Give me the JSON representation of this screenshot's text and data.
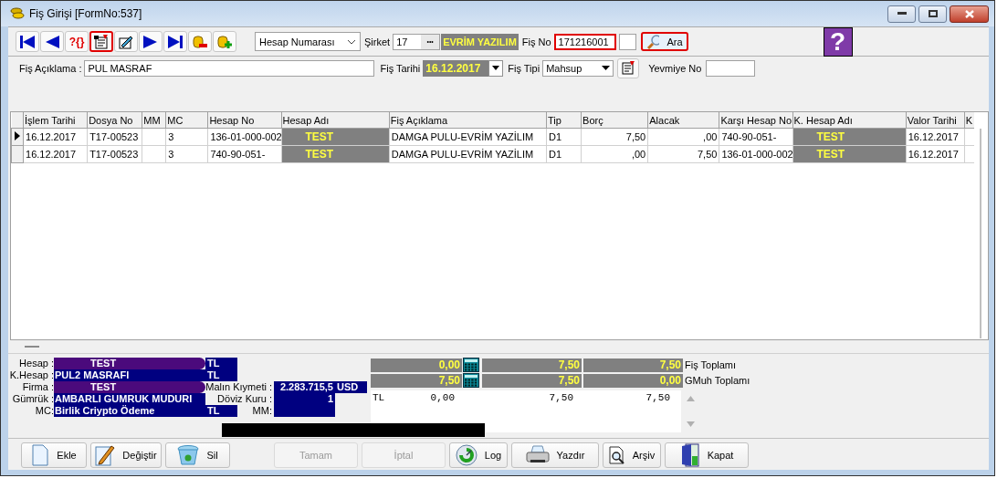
{
  "window": {
    "title": "Fiş Girişi [FormNo:537]"
  },
  "toolbar": [
    {
      "kind": "first",
      "highlighted": false
    },
    {
      "kind": "prev",
      "highlighted": false
    },
    {
      "kind": "query",
      "label": "?{}",
      "highlighted": false
    },
    {
      "kind": "import",
      "highlighted": true
    },
    {
      "kind": "edit",
      "highlighted": false
    },
    {
      "kind": "next",
      "highlighted": false
    },
    {
      "kind": "last",
      "highlighted": false
    },
    {
      "kind": "remove",
      "highlighted": false
    },
    {
      "kind": "add",
      "highlighted": false
    }
  ],
  "lookup": {
    "value": "Hesap Numarası"
  },
  "company": {
    "label": "Şirket",
    "value": "17",
    "button": "•••",
    "name": "EVRİM YAZILIM"
  },
  "fis_no": {
    "label": "Fiş No",
    "value": "171216001",
    "highlighted": true
  },
  "search_button": {
    "label": "Ara",
    "highlighted": true
  },
  "help": {
    "label": "?"
  },
  "fis_aciklama": {
    "label": "Fiş Açıklama :",
    "value": "PUL MASRAF"
  },
  "fis_tarihi": {
    "label": "Fiş Tarihi",
    "value": "16.12.2017"
  },
  "fis_tipi": {
    "label": "Fiş  Tipi",
    "value": "Mahsup"
  },
  "yevmiye_no": {
    "label": "Yevmiye No"
  },
  "table": {
    "columns": [
      {
        "label": "İşlem Tarihi",
        "kind": "text"
      },
      {
        "label": "Dosya No",
        "kind": "text"
      },
      {
        "label": "MM",
        "kind": "text"
      },
      {
        "label": "MC",
        "kind": "text"
      },
      {
        "label": "Hesap No",
        "kind": "text"
      },
      {
        "label": "Hesap Adı",
        "kind": "name"
      },
      {
        "label": "Fiş Açıklama",
        "kind": "text"
      },
      {
        "label": "Tip",
        "kind": "text"
      },
      {
        "label": "Borç",
        "kind": "amount"
      },
      {
        "label": "Alacak",
        "kind": "amount"
      },
      {
        "label": "Karşı Hesap No",
        "kind": "text"
      },
      {
        "label": "K. Hesap Adı",
        "kind": "name"
      },
      {
        "label": "Valor Tarihi",
        "kind": "text"
      },
      {
        "label": "K",
        "kind": "text"
      }
    ],
    "rows": [
      {
        "selected": true,
        "cells": [
          "16.12.2017",
          "T17-00523",
          "",
          "3",
          "136-01-000-002",
          "TEST",
          "DAMGA PULU-EVRİM YAZİLIM",
          "D1",
          "7,50",
          ",00",
          "740-90-051-",
          "TEST",
          "16.12.2017",
          ""
        ]
      },
      {
        "selected": false,
        "cells": [
          "16.12.2017",
          "T17-00523",
          "",
          "3",
          "740-90-051-",
          "TEST",
          "DAMGA PULU-EVRİM YAZİLIM",
          "D1",
          ",00",
          "7,50",
          "136-01-000-002",
          "TEST",
          "16.12.2017",
          ""
        ]
      }
    ]
  },
  "info_fields": [
    {
      "label": "Hesap :",
      "value": "TEST",
      "masked": true,
      "currency": "TL"
    },
    {
      "label": "K.Hesap :",
      "value": "PUL2 MASRAFI",
      "masked": false,
      "currency": "TL"
    },
    {
      "label": "Firma :",
      "value": "TEST",
      "masked": true,
      "side_label": "Malın Kıymeti :",
      "side_value": "2.283.715,5",
      "side_unit": "USD"
    },
    {
      "label": "Gümrük :",
      "value": "AMBARLI  GUMRUK MUDURI",
      "masked": false,
      "side_label": "Döviz Kuru :",
      "side_value": "1"
    },
    {
      "label": "MC:",
      "value": "Birlik Criypto Ödeme",
      "masked": false,
      "currency": "TL",
      "side_label": "MM:"
    }
  ],
  "totals": [
    {
      "label": "Fiş Toplamı",
      "values": [
        "0,00",
        "7,50",
        "7,50"
      ]
    },
    {
      "label": "GMuh Toplamı",
      "values": [
        "7,50",
        "7,50",
        "0,00"
      ]
    }
  ],
  "currency_summary": [
    {
      "currency": "TL",
      "values": [
        "0,00",
        "7,50",
        "7,50"
      ]
    }
  ],
  "buttons": [
    {
      "label": "Ekle",
      "kind": "add",
      "disabled": false
    },
    {
      "label": "Değiştir",
      "kind": "edit",
      "disabled": false
    },
    {
      "label": "Sil",
      "kind": "delete",
      "disabled": false
    },
    {
      "label": "Tamam",
      "kind": "plain",
      "disabled": true
    },
    {
      "label": "İptal",
      "kind": "plain",
      "disabled": true
    },
    {
      "label": "Log",
      "kind": "log",
      "disabled": false
    },
    {
      "label": "Yazdır",
      "kind": "print",
      "disabled": false
    },
    {
      "label": "Arşiv",
      "kind": "archive",
      "disabled": false
    },
    {
      "label": "Kapat",
      "kind": "close",
      "disabled": false
    }
  ]
}
